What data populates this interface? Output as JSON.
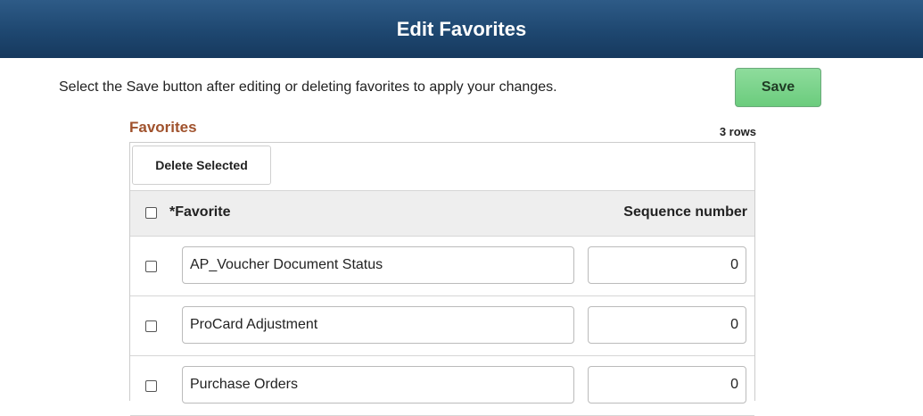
{
  "page": {
    "title": "Edit Favorites"
  },
  "instructions": "Select the Save button after editing or deleting favorites to apply your changes.",
  "save_label": "Save",
  "grid": {
    "title": "Favorites",
    "row_count": "3 rows",
    "delete_selected_label": "Delete Selected",
    "columns": {
      "select": "",
      "favorite": "*Favorite",
      "sequence": "Sequence number"
    },
    "rows": [
      {
        "favorite": "AP_Voucher Document Status",
        "sequence": "0",
        "selected": false
      },
      {
        "favorite": "ProCard Adjustment",
        "sequence": "0",
        "selected": false
      },
      {
        "favorite": "Purchase Orders",
        "sequence": "0",
        "selected": false
      }
    ]
  },
  "colors": {
    "title_bar": "#1e4770",
    "save_button": "#6bcc7d",
    "grid_title": "#a0522d",
    "header_row": "#eeeeee"
  }
}
